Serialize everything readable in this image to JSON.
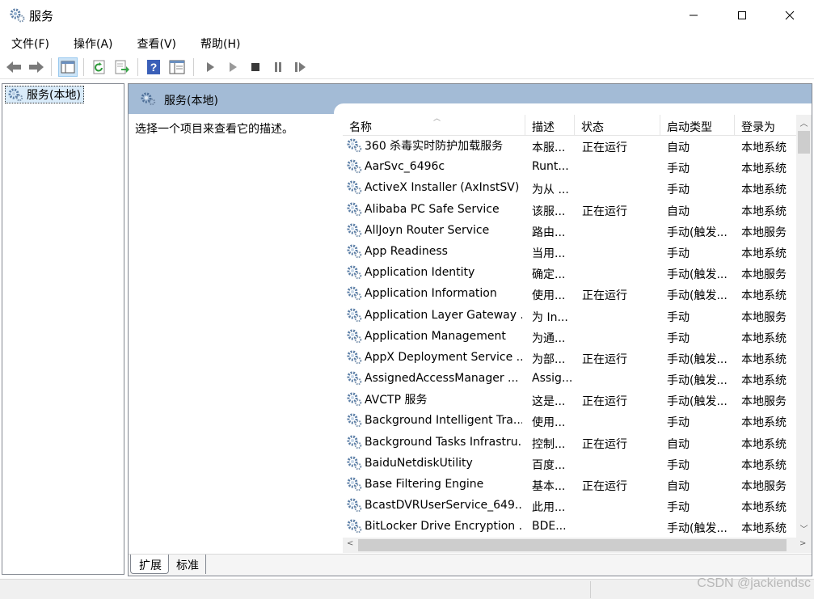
{
  "window": {
    "title": "服务",
    "icon": "services-gear-icon"
  },
  "menu": [
    "文件(F)",
    "操作(A)",
    "查看(V)",
    "帮助(H)"
  ],
  "toolbar": {
    "buttons": [
      "back",
      "forward",
      "show-hide-console-tree",
      "refresh",
      "export-list",
      "help",
      "properties",
      "start",
      "start-alt",
      "stop",
      "pause",
      "restart"
    ]
  },
  "tree": {
    "item_label": "服务(本地)"
  },
  "panel": {
    "header_title": "服务(本地)",
    "description_prompt": "选择一个项目来查看它的描述。"
  },
  "columns": {
    "name": "名称",
    "desc": "描述",
    "status": "状态",
    "startup": "启动类型",
    "logon": "登录为"
  },
  "services": [
    {
      "name": "360 杀毒实时防护加载服务",
      "desc": "本服...",
      "status": "正在运行",
      "startup": "自动",
      "logon": "本地系统"
    },
    {
      "name": "AarSvc_6496c",
      "desc": "Runt...",
      "status": "",
      "startup": "手动",
      "logon": "本地系统"
    },
    {
      "name": "ActiveX Installer (AxInstSV)",
      "desc": "为从 ...",
      "status": "",
      "startup": "手动",
      "logon": "本地系统"
    },
    {
      "name": "Alibaba PC Safe Service",
      "desc": "该服...",
      "status": "正在运行",
      "startup": "自动",
      "logon": "本地系统"
    },
    {
      "name": "AllJoyn Router Service",
      "desc": "路由...",
      "status": "",
      "startup": "手动(触发...",
      "logon": "本地服务"
    },
    {
      "name": "App Readiness",
      "desc": "当用...",
      "status": "",
      "startup": "手动",
      "logon": "本地系统"
    },
    {
      "name": "Application Identity",
      "desc": "确定...",
      "status": "",
      "startup": "手动(触发...",
      "logon": "本地服务"
    },
    {
      "name": "Application Information",
      "desc": "使用...",
      "status": "正在运行",
      "startup": "手动(触发...",
      "logon": "本地系统"
    },
    {
      "name": "Application Layer Gateway ...",
      "desc": "为 In...",
      "status": "",
      "startup": "手动",
      "logon": "本地服务"
    },
    {
      "name": "Application Management",
      "desc": "为通...",
      "status": "",
      "startup": "手动",
      "logon": "本地系统"
    },
    {
      "name": "AppX Deployment Service ...",
      "desc": "为部...",
      "status": "正在运行",
      "startup": "手动(触发...",
      "logon": "本地系统"
    },
    {
      "name": "AssignedAccessManager ...",
      "desc": "Assig...",
      "status": "",
      "startup": "手动(触发...",
      "logon": "本地系统"
    },
    {
      "name": "AVCTP 服务",
      "desc": "这是...",
      "status": "正在运行",
      "startup": "手动(触发...",
      "logon": "本地服务"
    },
    {
      "name": "Background Intelligent Tra...",
      "desc": "使用...",
      "status": "",
      "startup": "手动",
      "logon": "本地系统"
    },
    {
      "name": "Background Tasks Infrastru...",
      "desc": "控制...",
      "status": "正在运行",
      "startup": "自动",
      "logon": "本地系统"
    },
    {
      "name": "BaiduNetdiskUtility",
      "desc": "百度...",
      "status": "",
      "startup": "手动",
      "logon": "本地系统"
    },
    {
      "name": "Base Filtering Engine",
      "desc": "基本...",
      "status": "正在运行",
      "startup": "自动",
      "logon": "本地服务"
    },
    {
      "name": "BcastDVRUserService_649...",
      "desc": "此用...",
      "status": "",
      "startup": "手动",
      "logon": "本地系统"
    },
    {
      "name": "BitLocker Drive Encryption ...",
      "desc": "BDE...",
      "status": "",
      "startup": "手动(触发...",
      "logon": "本地系统"
    }
  ],
  "tabs": [
    "扩展",
    "标准"
  ],
  "watermark": "CSDN @jackiendsc"
}
